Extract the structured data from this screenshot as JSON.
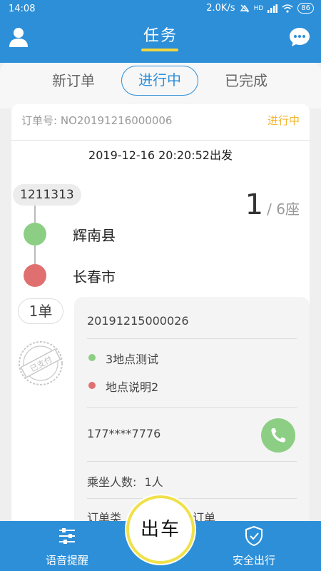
{
  "status_bar": {
    "time": "14:08",
    "network_speed": "2.0K/s",
    "network_type": "HD",
    "battery": "86"
  },
  "header": {
    "title": "任务"
  },
  "tabs": [
    {
      "label": "新订单"
    },
    {
      "label": "进行中"
    },
    {
      "label": "已完成"
    }
  ],
  "order": {
    "number_label": "订单号:",
    "number": "NO20191216000006",
    "status": "进行中",
    "departure_time": "2019-12-16 20:20:52出发",
    "plate": "1211313",
    "seats_taken": "1",
    "seats_total": "/ 6座",
    "from_city": "辉南县",
    "to_city": "长春市",
    "order_count": "1单",
    "stamp": "已支付"
  },
  "detail": {
    "sub_order": "20191215000026",
    "pickup": "3地点测试",
    "dropoff": "地点说明2",
    "phone": "177****7776",
    "passengers_label": "乘坐人数:",
    "passengers_value": "1人",
    "order_type_partial_left": "订单类",
    "order_type_partial_right": "订单"
  },
  "bottom": {
    "left_label": "语音提醒",
    "center_label": "出车",
    "right_label": "安全出行"
  },
  "colors": {
    "brand_blue": "#2d8fd8",
    "status_orange": "#f2b630",
    "start_green": "#8ccf84",
    "end_red": "#e07070",
    "accent_yellow": "#f0e04a"
  }
}
